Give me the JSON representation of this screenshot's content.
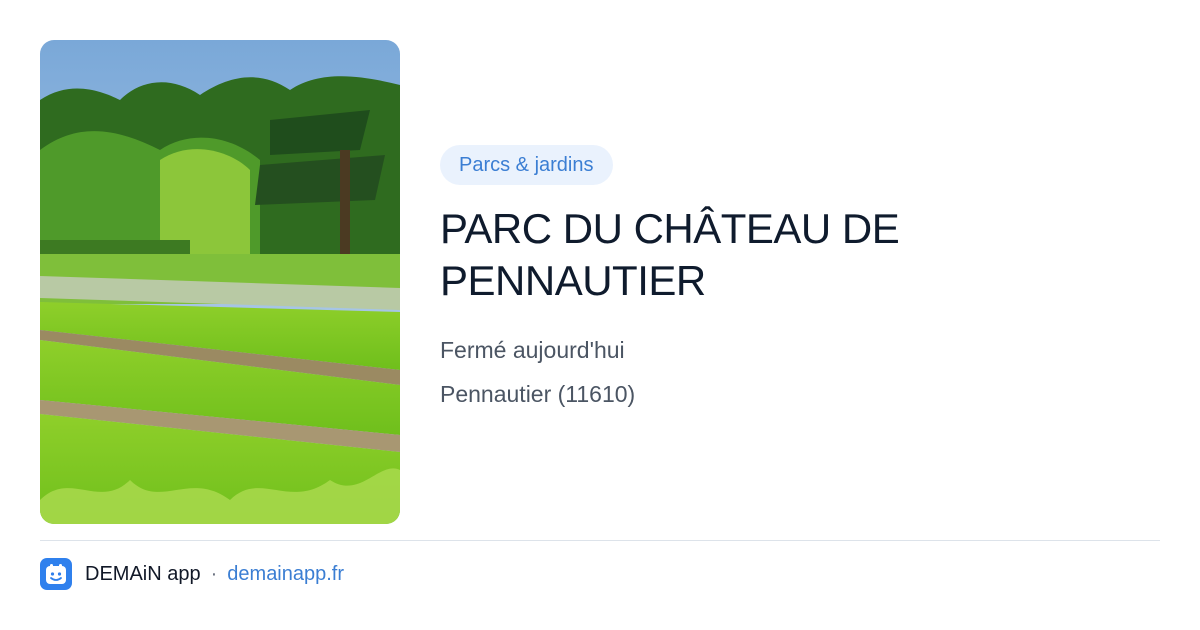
{
  "card": {
    "image_alt": "Pelouses et arbres du parc",
    "category": "Parcs & jardins",
    "title_line1": "PARC DU CHÂTEAU DE",
    "title_line2": "PENNAUTIER",
    "status": "Fermé aujourd'hui",
    "location": "Pennautier (11610)"
  },
  "footer": {
    "app_icon": "calendar-face-icon",
    "app_name": "DEMAiN app",
    "separator": "·",
    "url": "demainapp.fr"
  },
  "colors": {
    "accent": "#3b7ed3",
    "tag_background": "#eaf2fd",
    "title": "#0f1b2d",
    "body_text": "#4b5563",
    "app_icon_bg": "#2f80ed"
  }
}
